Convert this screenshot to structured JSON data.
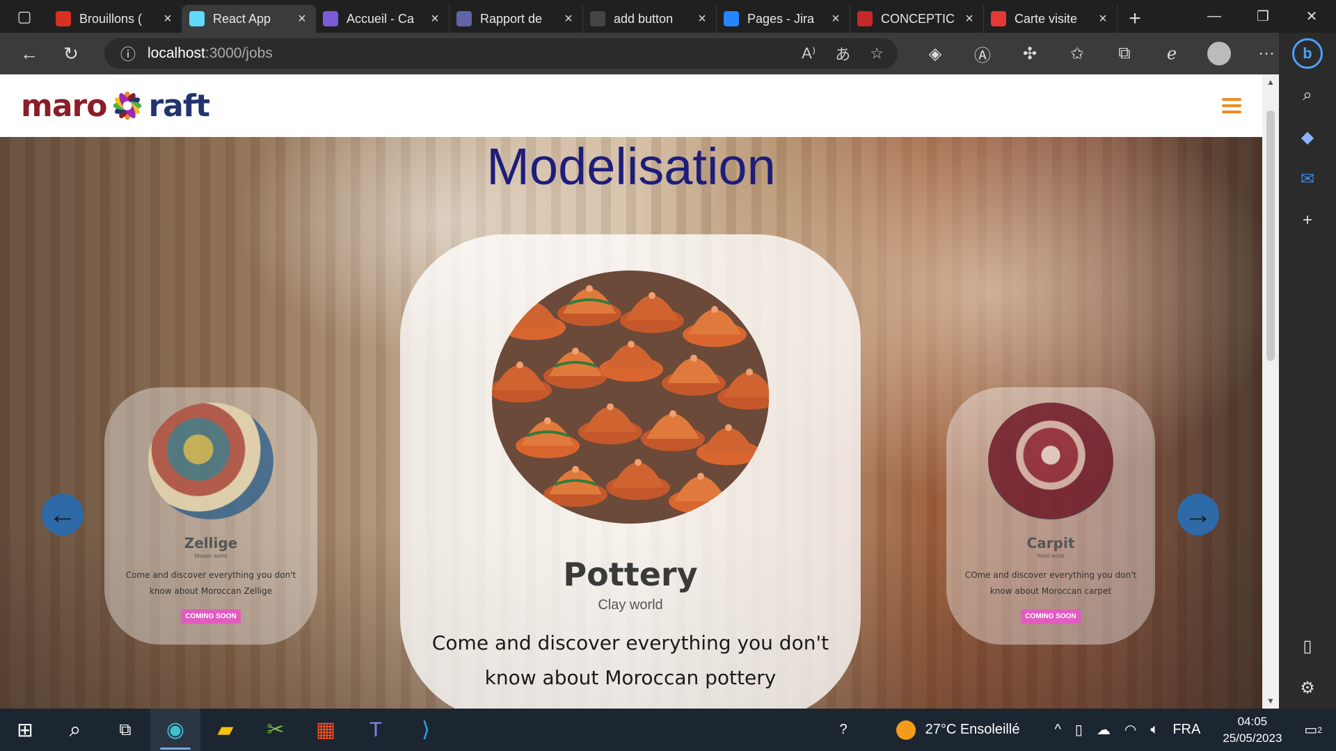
{
  "browser": {
    "tabs": [
      {
        "label": "Brouillons (",
        "icon": "gmail-icon",
        "color": "#d93025",
        "active": false
      },
      {
        "label": "React App",
        "icon": "react-icon",
        "color": "#61dafb",
        "active": true
      },
      {
        "label": "Accueil - Ca",
        "icon": "canva-icon",
        "color": "#7b5cd6",
        "active": false
      },
      {
        "label": "Rapport de",
        "icon": "teams-icon",
        "color": "#6264a7",
        "active": false
      },
      {
        "label": "add button",
        "icon": "github-icon",
        "color": "#444444",
        "active": false
      },
      {
        "label": "Pages - Jira",
        "icon": "jira-icon",
        "color": "#2684ff",
        "active": false
      },
      {
        "label": "CONCEPTIC",
        "icon": "pdf-icon",
        "color": "#c62828",
        "active": false
      },
      {
        "label": "Carte visite",
        "icon": "pdf-icon",
        "color": "#e53935",
        "active": false
      }
    ],
    "url_host": "localhost",
    "url_path": ":3000/jobs"
  },
  "site": {
    "logo_left": "maro",
    "logo_right": "raft",
    "hero_title": "Modelisation",
    "cards": {
      "left": {
        "title": "Zellige",
        "subtitle": "Mosaic world",
        "description": "Come and discover everything you don't know about Moroccan Zellige",
        "badge": "COMING SOON"
      },
      "center": {
        "title": "Pottery",
        "subtitle": "Clay world",
        "description": "Come and discover everything you don't know about Moroccan pottery"
      },
      "right": {
        "title": "Carpit",
        "subtitle": "Wool world",
        "description": "COme and discover everything you don't know about Moroccan carpet",
        "badge": "COMING SOON"
      }
    },
    "colors": {
      "title": "#1d1d7a",
      "burger": "#f08a24",
      "arrow": "#2e6aa8",
      "badge": "#e25cc0"
    }
  },
  "taskbar": {
    "weather": "27°C  Ensoleillé",
    "language": "FRA",
    "time": "04:05",
    "date": "25/05/2023",
    "notifications": "2"
  }
}
